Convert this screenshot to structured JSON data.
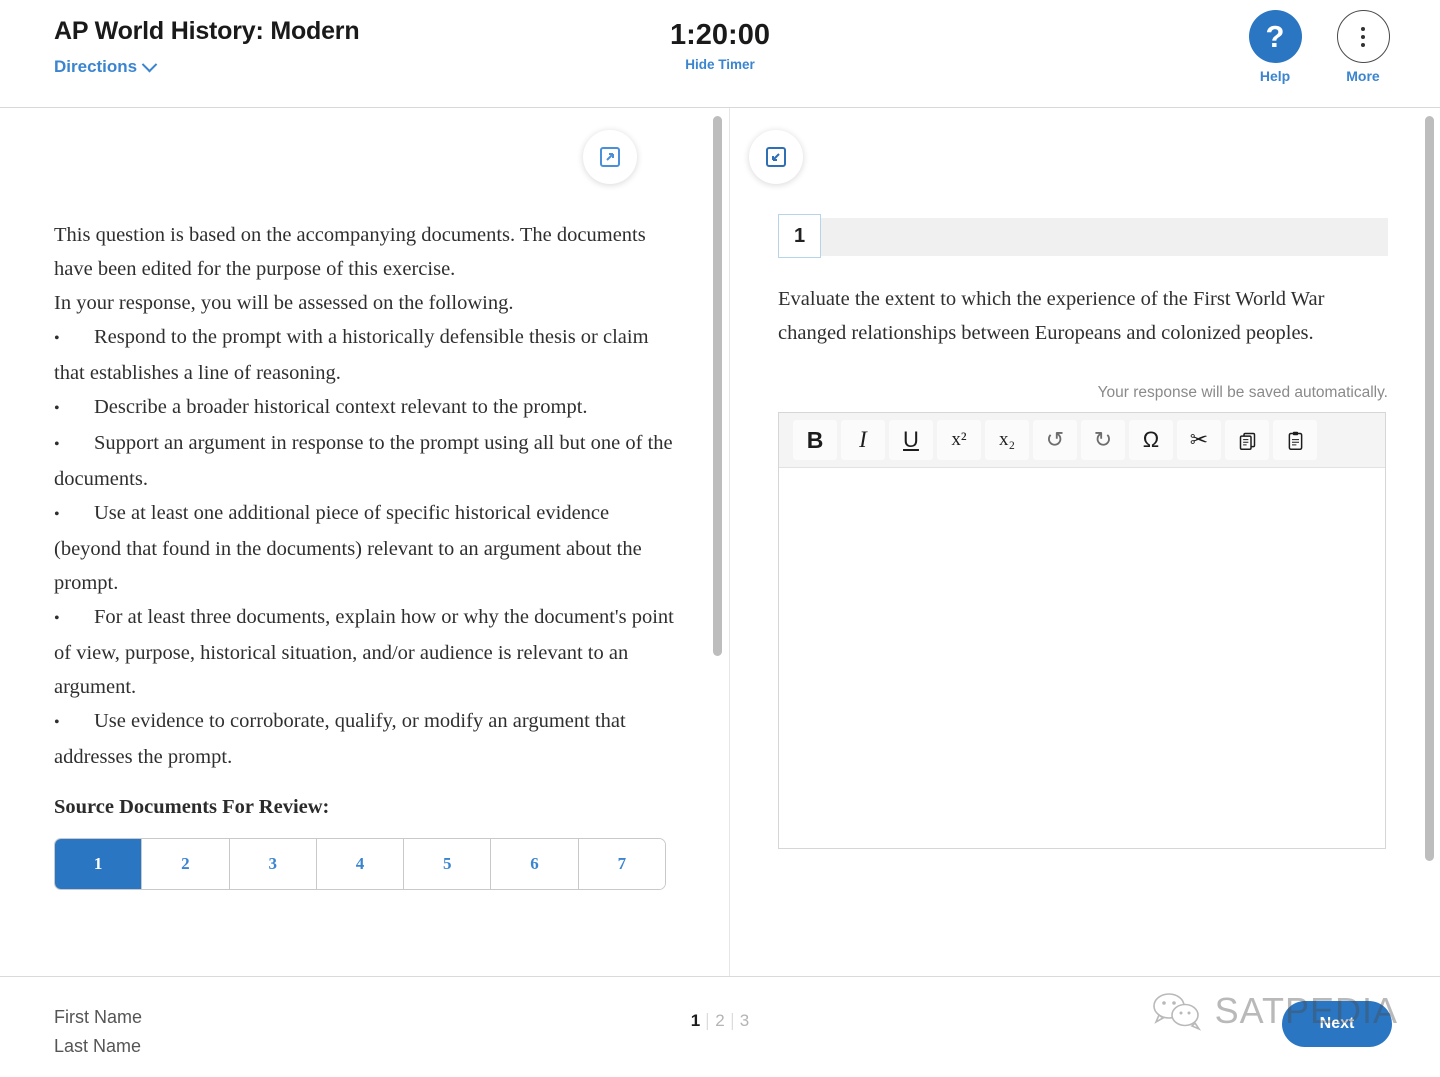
{
  "header": {
    "test_title": "AP World History: Modern",
    "directions_label": "Directions",
    "timer": "1:20:00",
    "hide_timer_label": "Hide Timer",
    "help_label": "Help",
    "help_glyph": "?",
    "more_label": "More"
  },
  "left_panel": {
    "expand_icon": "expand-icon",
    "paragraphs": [
      "This question is based on the accompanying documents. The documents have been edited for the purpose of this exercise.",
      "In your response, you will be assessed on the following."
    ],
    "bullets": [
      "Respond to the prompt with a historically defensible thesis or claim that establishes a line of reasoning.",
      "Describe a broader historical context relevant to the prompt.",
      "Support an argument in response to the prompt using all but one of the documents.",
      "Use at least one additional piece of specific historical evidence (beyond that found in the documents) relevant to an argument about the prompt.",
      "For at least three documents, explain how or why the document's point of view, purpose, historical situation, and/or audience is relevant to an argument.",
      "Use evidence to corroborate, qualify, or modify an argument that addresses the prompt."
    ],
    "source_documents_heading": "Source Documents For Review:",
    "document_tabs": [
      "1",
      "2",
      "3",
      "4",
      "5",
      "6",
      "7"
    ],
    "active_document_tab": "1"
  },
  "right_panel": {
    "collapse_icon": "collapse-icon",
    "question_number": "1",
    "question_prompt": "Evaluate the extent to which the experience of the First World War changed relationships between Europeans and colonized peoples.",
    "autosave_note": "Your response will be saved automatically.",
    "toolbar": [
      {
        "name": "bold-button",
        "glyph": "B",
        "style": "tb-bold"
      },
      {
        "name": "italic-button",
        "glyph": "I",
        "style": "tb-ital"
      },
      {
        "name": "underline-button",
        "glyph": "U",
        "style": "tb-under"
      },
      {
        "name": "superscript-button",
        "glyph": "x²",
        "style": "tb-sup"
      },
      {
        "name": "subscript-button",
        "glyph": "x₂",
        "style": "tb-sub"
      },
      {
        "name": "undo-button",
        "glyph": "↺",
        "style": "dim"
      },
      {
        "name": "redo-button",
        "glyph": "↻",
        "style": "dim"
      },
      {
        "name": "special-character-button",
        "glyph": "Ω",
        "style": "sans"
      },
      {
        "name": "cut-button",
        "glyph": "✂",
        "style": "sans"
      },
      {
        "name": "copy-button",
        "glyph": "❐",
        "style": "sans"
      },
      {
        "name": "paste-button",
        "glyph": "📋",
        "style": "sans"
      }
    ],
    "response_value": "",
    "response_placeholder": ""
  },
  "footer": {
    "first_name_label": "First Name",
    "last_name_label": "Last Name",
    "pages": [
      "1",
      "2",
      "3"
    ],
    "active_page": "1",
    "next_label": "Next"
  },
  "watermark": {
    "text": "SATPEDIA",
    "icon": "wechat-icon"
  },
  "colors": {
    "accent_blue": "#2a76c2",
    "link_blue": "#3b85d0",
    "badge_border": "#b6d4ea",
    "toolbar_bg": "#f4f4f4",
    "question_bar_bg": "#f0f0f0"
  }
}
